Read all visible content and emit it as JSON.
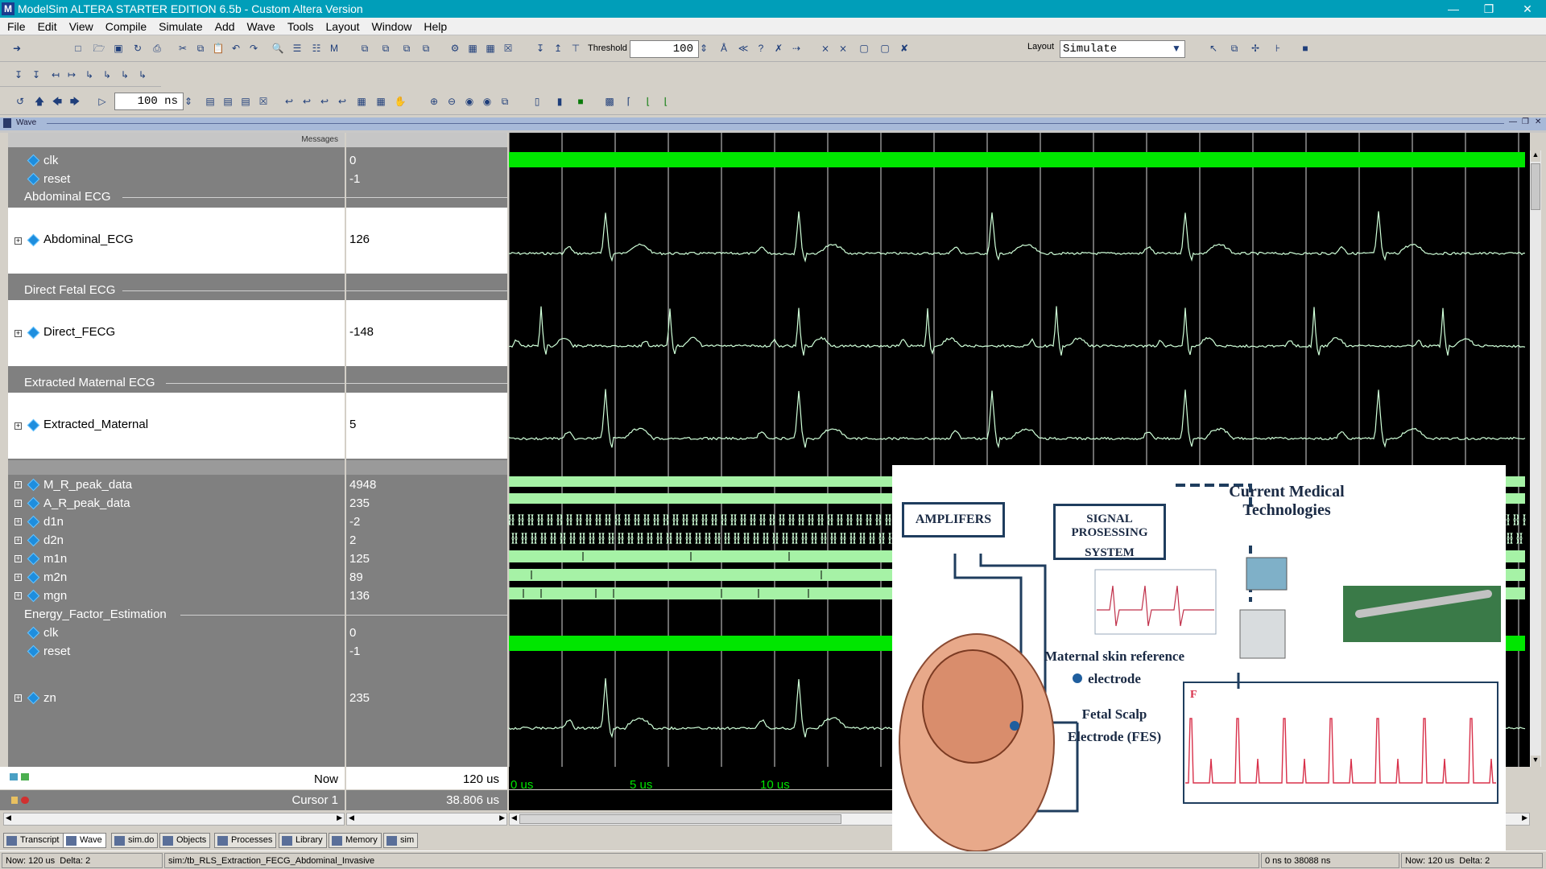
{
  "window": {
    "title": "ModelSim ALTERA STARTER EDITION 6.5b - Custom Altera Version",
    "app_letter": "M"
  },
  "menu": [
    "File",
    "Edit",
    "View",
    "Compile",
    "Simulate",
    "Add",
    "Wave",
    "Tools",
    "Layout",
    "Window",
    "Help"
  ],
  "toolbar": {
    "threshold_label": "Threshold",
    "threshold_value": "100",
    "layout_label": "Layout",
    "layout_value": "Simulate",
    "runtime_value": "100 ns"
  },
  "wave_panel": {
    "title": "Wave",
    "messages_header": "Messages",
    "signals": [
      {
        "name": "clk",
        "value": "0"
      },
      {
        "name": "reset",
        "value": "-1"
      },
      {
        "group": "Abdominal ECG"
      },
      {
        "name": "Abdominal_ECG",
        "value": "126"
      },
      {
        "group": "Direct Fetal ECG"
      },
      {
        "name": "Direct_FECG",
        "value": "-148"
      },
      {
        "group": "Extracted Maternal ECG"
      },
      {
        "name": "Extracted_Maternal",
        "value": "5"
      },
      {
        "name": "M_R_peak_data",
        "value": "4948"
      },
      {
        "name": "A_R_peak_data",
        "value": "235"
      },
      {
        "name": "d1n",
        "value": "-2"
      },
      {
        "name": "d2n",
        "value": "2"
      },
      {
        "name": "m1n",
        "value": "125"
      },
      {
        "name": "m2n",
        "value": "89"
      },
      {
        "name": "mgn",
        "value": "136"
      },
      {
        "group": "Energy_Factor_Estimation"
      },
      {
        "name": "clk",
        "value": "0"
      },
      {
        "name": "reset",
        "value": "-1"
      },
      {
        "name": "zn",
        "value": "235"
      }
    ],
    "now_label": "Now",
    "now_value": "120 us",
    "cursor_label": "Cursor 1",
    "cursor_value": "38.806 us",
    "time_ticks": [
      "0 us",
      "5 us",
      "10 us"
    ]
  },
  "tabs": [
    "Transcript",
    "Wave",
    "sim.do",
    "Objects",
    "Processes",
    "Library",
    "Memory",
    "sim"
  ],
  "status": {
    "now": "Now: 120 us",
    "delta": "Delta: 2",
    "path": "sim:/tb_RLS_Extraction_FECG_Abdominal_Invasive",
    "range": "0 ns to 38088 ns",
    "now2": "Now: 120 us",
    "delta2": "Delta: 2"
  },
  "overlay": {
    "heading": "Current Medical Technologies",
    "amplifiers": "AMPLIFERS",
    "signal_processing_1": "SIGNAL PROSESSING",
    "signal_processing_2": "SYSTEM",
    "maternal_1": "Maternal skin reference",
    "maternal_2": "electrode",
    "fetal_1": "Fetal Scalp",
    "fetal_2": "Electrode (FES)",
    "f_marker": "F"
  },
  "colors": {
    "wave_green": "#00ff00",
    "bus_fill": "#a6f2a6",
    "analog": "#cfffd8",
    "title_bar": "#009eb9"
  }
}
